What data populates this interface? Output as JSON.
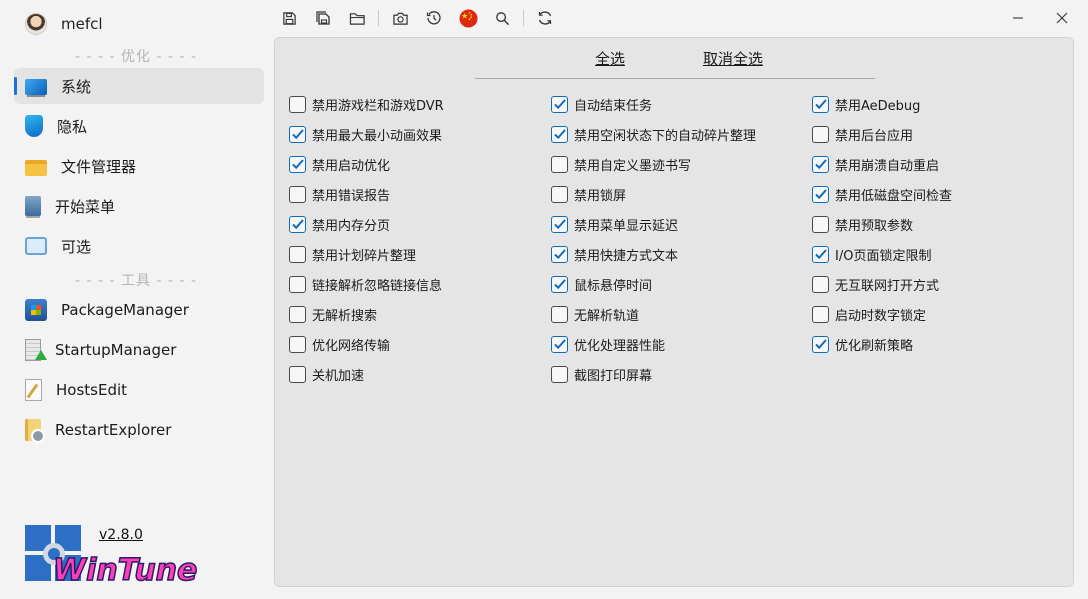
{
  "window": {
    "username": "mefcl",
    "version": "v2.8.0",
    "logo_text": "WinTune"
  },
  "sidebar": {
    "section_optimize": "- - - - 优化 - - - -",
    "section_tools": "- - - - 工具 - - - -",
    "items": [
      {
        "label": "系统",
        "icon": "monitor-icon",
        "active": true
      },
      {
        "label": "隐私",
        "icon": "shield-icon"
      },
      {
        "label": "文件管理器",
        "icon": "folder-icon"
      },
      {
        "label": "开始菜单",
        "icon": "start-menu-icon"
      },
      {
        "label": "可选",
        "icon": "options-icon"
      }
    ],
    "tools": [
      {
        "label": "PackageManager",
        "icon": "package-icon"
      },
      {
        "label": "StartupManager",
        "icon": "startup-icon"
      },
      {
        "label": "HostsEdit",
        "icon": "hosts-edit-icon"
      },
      {
        "label": "RestartExplorer",
        "icon": "restart-explorer-icon"
      }
    ]
  },
  "toolbar": {
    "icons": [
      "save-icon",
      "save-all-icon",
      "open-folder-icon",
      "camera-icon",
      "history-icon",
      "language-flag-icon",
      "search-icon",
      "refresh-icon"
    ]
  },
  "main": {
    "select_all": "全选",
    "deselect_all": "取消全选",
    "columns": [
      [
        {
          "label": "禁用游戏栏和游戏DVR",
          "checked": false
        },
        {
          "label": "禁用最大最小动画效果",
          "checked": true
        },
        {
          "label": "禁用启动优化",
          "checked": true
        },
        {
          "label": "禁用错误报告",
          "checked": false
        },
        {
          "label": "禁用内存分页",
          "checked": true
        },
        {
          "label": "禁用计划碎片整理",
          "checked": false
        },
        {
          "label": "链接解析忽略链接信息",
          "checked": false
        },
        {
          "label": "无解析搜索",
          "checked": false
        },
        {
          "label": "优化网络传输",
          "checked": false
        },
        {
          "label": "关机加速",
          "checked": false
        }
      ],
      [
        {
          "label": "自动结束任务",
          "checked": true
        },
        {
          "label": "禁用空闲状态下的自动碎片整理",
          "checked": true
        },
        {
          "label": "禁用自定义墨迹书写",
          "checked": false
        },
        {
          "label": "禁用锁屏",
          "checked": false
        },
        {
          "label": "禁用菜单显示延迟",
          "checked": true
        },
        {
          "label": "禁用快捷方式文本",
          "checked": true
        },
        {
          "label": "鼠标悬停时间",
          "checked": true
        },
        {
          "label": "无解析轨道",
          "checked": false
        },
        {
          "label": "优化处理器性能",
          "checked": true
        },
        {
          "label": "截图打印屏幕",
          "checked": false
        }
      ],
      [
        {
          "label": "禁用AeDebug",
          "checked": true
        },
        {
          "label": "禁用后台应用",
          "checked": false
        },
        {
          "label": "禁用崩溃自动重启",
          "checked": true
        },
        {
          "label": "禁用低磁盘空间检查",
          "checked": true
        },
        {
          "label": "禁用预取参数",
          "checked": false
        },
        {
          "label": "I/O页面锁定限制",
          "checked": true
        },
        {
          "label": "无互联网打开方式",
          "checked": false
        },
        {
          "label": "启动时数字锁定",
          "checked": false
        },
        {
          "label": "优化刷新策略",
          "checked": true
        }
      ]
    ]
  },
  "colors": {
    "accent": "#0f6cbd",
    "panel_bg": "#e5e5e5",
    "window_bg": "#f3f3f3"
  }
}
